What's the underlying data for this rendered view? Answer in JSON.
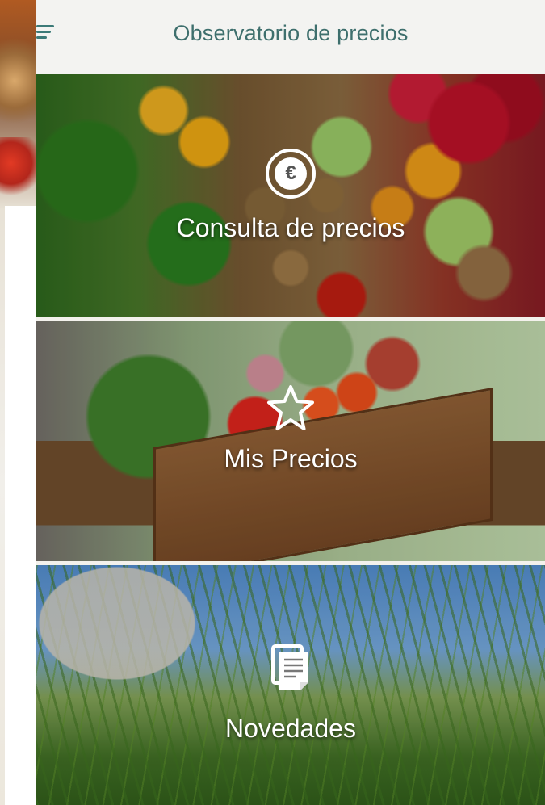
{
  "appbar": {
    "title": "Observatorio de precios",
    "menu_icon": "hamburger-menu-icon",
    "accent_color": "#3e6f6d"
  },
  "cards": [
    {
      "label": "Consulta de precios",
      "icon": "euro-coin-icon"
    },
    {
      "label": "Mis Precios",
      "icon": "star-icon"
    },
    {
      "label": "Novedades",
      "icon": "document-icon"
    }
  ]
}
